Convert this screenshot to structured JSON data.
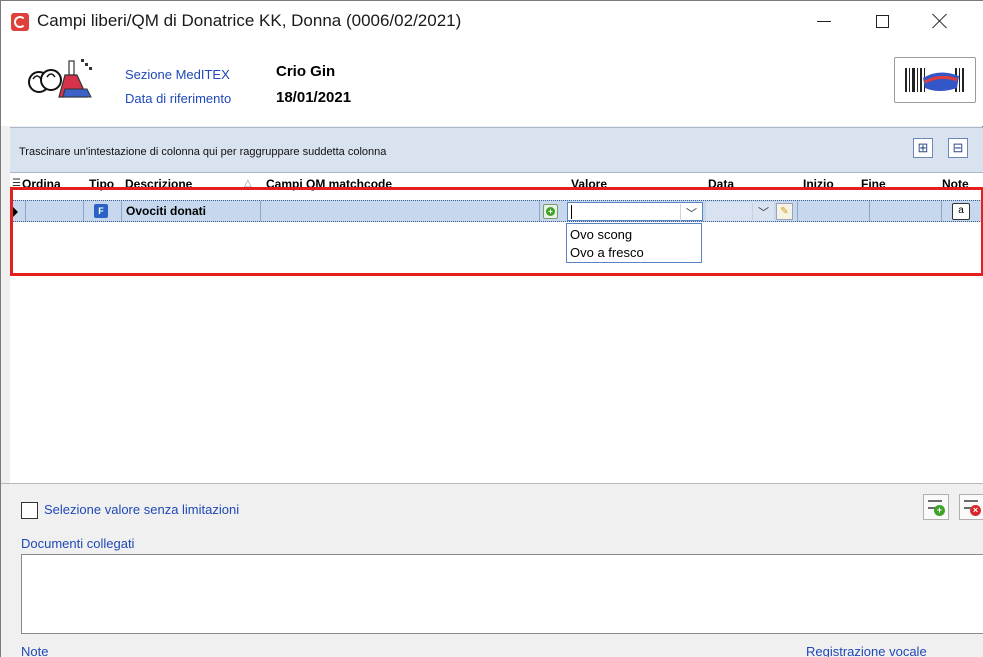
{
  "window": {
    "title": "Campi liberi/QM di Donatrice KK, Donna (0006/02/2021)"
  },
  "header": {
    "section_label": "Sezione MedITEX",
    "section_value": "Crio Gin",
    "date_label": "Data di riferimento",
    "date_value": "18/01/2021"
  },
  "groupbar": {
    "hint": "Trascinare un'intestazione di colonna qui per raggruppare suddetta colonna",
    "expand_symbol": "⊞",
    "collapse_symbol": "⊟"
  },
  "grid": {
    "columns": [
      "Ordina",
      "Tipo",
      "Descrizione",
      "Campi QM matchcode",
      "Valore",
      "Data",
      "Inizio",
      "Fine",
      "Note"
    ],
    "rows": [
      {
        "tipo_icon": "F",
        "descrizione": "Ovociti donati",
        "valore": ""
      }
    ],
    "dropdown_options": [
      "Ovo scong",
      "Ovo a fresco"
    ]
  },
  "bottom": {
    "checkbox_label": "Selezione valore senza limitazioni",
    "docs_label": "Documenti collegati",
    "note_label": "Note",
    "recording_label": "Registrazione vocale"
  },
  "colors": {
    "highlight_frame": "#e41f1f",
    "row_selected": "#c6d7ee",
    "link_text": "#1f49b6"
  }
}
